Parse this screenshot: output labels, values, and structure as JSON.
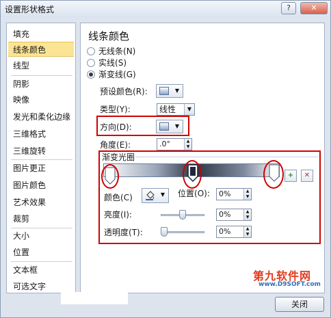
{
  "window": {
    "title": "设置形状格式",
    "help_label": "?",
    "close_label": "✕"
  },
  "sidebar": {
    "items": [
      {
        "label": "填充"
      },
      {
        "label": "线条颜色",
        "selected": true
      },
      {
        "label": "线型"
      },
      {
        "label": "阴影"
      },
      {
        "label": "映像"
      },
      {
        "label": "发光和柔化边缘"
      },
      {
        "label": "三维格式"
      },
      {
        "label": "三维旋转"
      },
      {
        "label": "图片更正"
      },
      {
        "label": "图片颜色"
      },
      {
        "label": "艺术效果"
      },
      {
        "label": "裁剪"
      },
      {
        "label": "大小"
      },
      {
        "label": "位置"
      },
      {
        "label": "文本框"
      },
      {
        "label": "可选文字"
      }
    ]
  },
  "panel": {
    "heading": "线条颜色",
    "radios": [
      {
        "label": "无线条",
        "key": "(N)",
        "checked": false
      },
      {
        "label": "实线",
        "key": "(S)",
        "checked": false
      },
      {
        "label": "渐变线",
        "key": "(G)",
        "checked": true
      }
    ],
    "preset_colors_label": "预设颜色",
    "preset_colors_key": "(R):",
    "type_label": "类型",
    "type_key": "(Y):",
    "type_value": "线性",
    "direction_label": "方向",
    "direction_key": "(D):",
    "angle_label": "角度",
    "angle_key": "(E):",
    "angle_value": ".0°",
    "gradient_stops_label": "渐变光圈",
    "add_stop_label": "+",
    "remove_stop_label": "✕",
    "color_label": "颜色",
    "color_key": "(C)",
    "position_label": "位置",
    "position_key": "(O):",
    "position_value": "0%",
    "brightness_label": "亮度",
    "brightness_key": "(I):",
    "brightness_value": "0%",
    "brightness_level": 0.5,
    "transparency_label": "透明度",
    "transparency_key": "(T):",
    "transparency_value": "0%",
    "transparency_level": 0.0
  },
  "footer": {
    "close_label": "关闭"
  },
  "watermark": {
    "main": "第九软件网",
    "sub": "www.D9SOFT.com"
  },
  "colors": {
    "selection": "#fce495",
    "annotation": "#d00000",
    "accent": "#8aa6cf"
  },
  "icons": {
    "swatch": "color-swatch-icon",
    "add_stop": "add-gradient-stop-icon",
    "remove_stop": "remove-gradient-stop-icon",
    "paint_bucket": "paint-bucket-icon"
  }
}
